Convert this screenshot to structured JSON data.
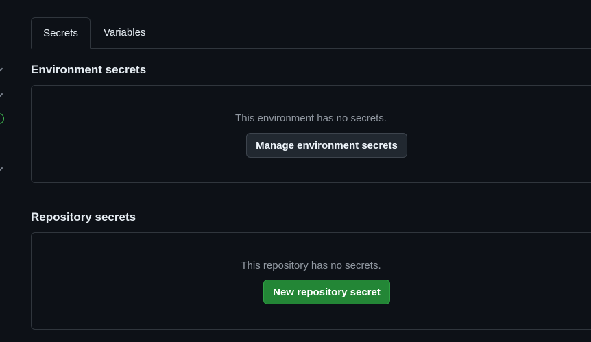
{
  "tabs": [
    {
      "label": "Secrets",
      "active": true
    },
    {
      "label": "Variables",
      "active": false
    }
  ],
  "environment_secrets": {
    "title": "Environment secrets",
    "empty_message": "This environment has no secrets.",
    "button_label": "Manage environment secrets"
  },
  "repository_secrets": {
    "title": "Repository secrets",
    "empty_message": "This repository has no secrets.",
    "button_label": "New repository secret"
  },
  "colors": {
    "background": "#0d1117",
    "border": "#30363d",
    "muted_text": "#9198a1",
    "primary_button": "#238636",
    "success_ring": "#3fb950"
  }
}
